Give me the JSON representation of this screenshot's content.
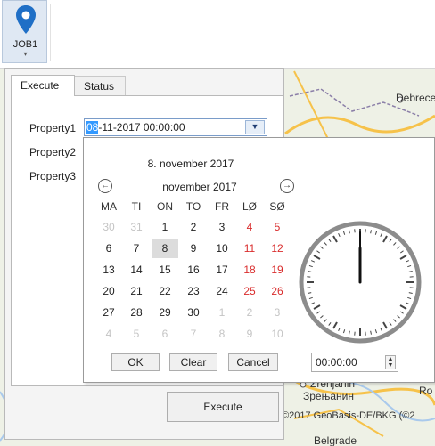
{
  "ribbon": {
    "job_label": "JOB1",
    "job_caret": "▾"
  },
  "panel": {
    "tabs": [
      {
        "label": "Execute",
        "active": true
      },
      {
        "label": "Status",
        "active": false
      }
    ],
    "properties": [
      {
        "label": "Property1"
      },
      {
        "label": "Property2"
      },
      {
        "label": "Property3"
      }
    ],
    "datetime": {
      "selected_part": "08",
      "rest": "-11-2017 00:00:00"
    },
    "execute_label": "Execute"
  },
  "calendar": {
    "title": "8. november 2017",
    "month_label": "november 2017",
    "nav_prev": "←",
    "nav_next": "→",
    "weekdays": [
      "MA",
      "TI",
      "ON",
      "TO",
      "FR",
      "LØ",
      "SØ"
    ],
    "weeks": [
      [
        "30",
        "31",
        "1",
        "2",
        "3",
        "4",
        "5"
      ],
      [
        "6",
        "7",
        "8",
        "9",
        "10",
        "11",
        "12"
      ],
      [
        "13",
        "14",
        "15",
        "16",
        "17",
        "18",
        "19"
      ],
      [
        "20",
        "21",
        "22",
        "23",
        "24",
        "25",
        "26"
      ],
      [
        "27",
        "28",
        "29",
        "30",
        "1",
        "2",
        "3"
      ],
      [
        "4",
        "5",
        "6",
        "7",
        "8",
        "9",
        "10"
      ]
    ],
    "selected_day": "8",
    "buttons": {
      "ok": "OK",
      "clear": "Clear",
      "cancel": "Cancel"
    },
    "time_value": "00:00:00",
    "clock": {
      "hour": 0,
      "minute": 0
    }
  },
  "map": {
    "labels": [
      "Debrece",
      "Zrenjanin",
      "Зрењанин",
      "©2017 GeoBasis-DE/BKG (©2",
      "Belgrade",
      "Ro"
    ],
    "colors": {
      "land": "#eef1e6",
      "road_major": "#f6c24a",
      "water": "#a9c9ec",
      "border": "#8b7fa8"
    }
  },
  "colors": {
    "accent": "#1f6fc6",
    "weekend": "#d92c2c",
    "selection": "#3399ff"
  }
}
